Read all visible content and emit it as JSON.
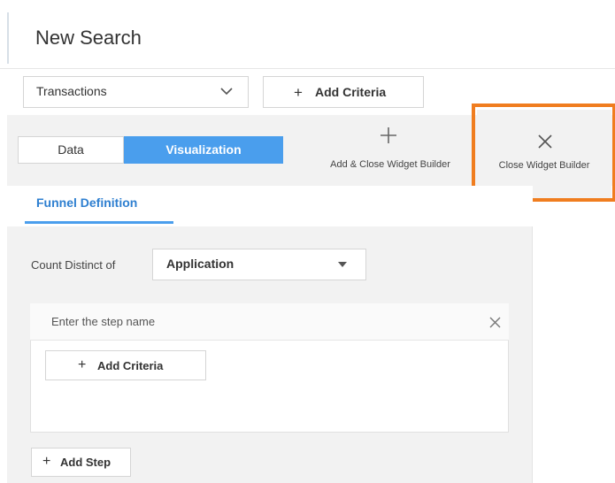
{
  "header": {
    "title": "New Search"
  },
  "search_bar": {
    "source_value": "Transactions",
    "add_criteria_label": "Add Criteria"
  },
  "toolbar": {
    "tabs": [
      {
        "label": "Data",
        "active": false
      },
      {
        "label": "Visualization",
        "active": true
      }
    ],
    "add_close_label": "Add & Close Widget Builder",
    "close_label": "Close Widget Builder"
  },
  "funnel": {
    "tab_label": "Funnel Definition",
    "count_distinct_label": "Count Distinct of",
    "count_distinct_value": "Application",
    "step": {
      "name_placeholder": "Enter the step name",
      "add_criteria_label": "Add Criteria"
    },
    "add_step_label": "Add Step"
  },
  "colors": {
    "accent": "#4a9eed",
    "link": "#2e7fd0",
    "highlight": "#f07d1f",
    "panel_bg": "#f2f2f2"
  },
  "icons": [
    "chevron-down-icon",
    "plus-icon",
    "close-icon",
    "caret-down-icon"
  ]
}
